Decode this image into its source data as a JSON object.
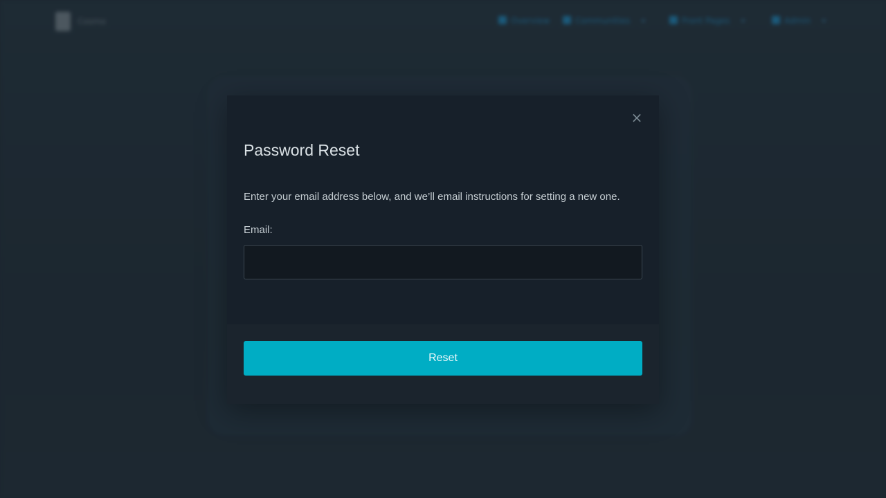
{
  "background": {
    "brand": "Cosmo",
    "nav": [
      {
        "label": "Overview",
        "icon": "grid-icon"
      },
      {
        "label": "Communities",
        "icon": "people-icon",
        "has_dropdown": true
      },
      {
        "label": "Front Pages",
        "icon": "page-icon",
        "has_dropdown": true
      },
      {
        "label": "Admin",
        "icon": "user-icon",
        "has_dropdown": true
      }
    ]
  },
  "modal": {
    "close_symbol": "×",
    "title": "Password Reset",
    "description": "Enter your email address below, and we’ll email instructions for setting a new one.",
    "email_label": "Email:",
    "email_value": "",
    "email_placeholder": "",
    "reset_label": "Reset"
  },
  "colors": {
    "page_background": "#1f2a33",
    "modal_background": "#17202a",
    "footer_background": "#1b242d",
    "input_background": "#121920",
    "accent": "#00adc4"
  }
}
